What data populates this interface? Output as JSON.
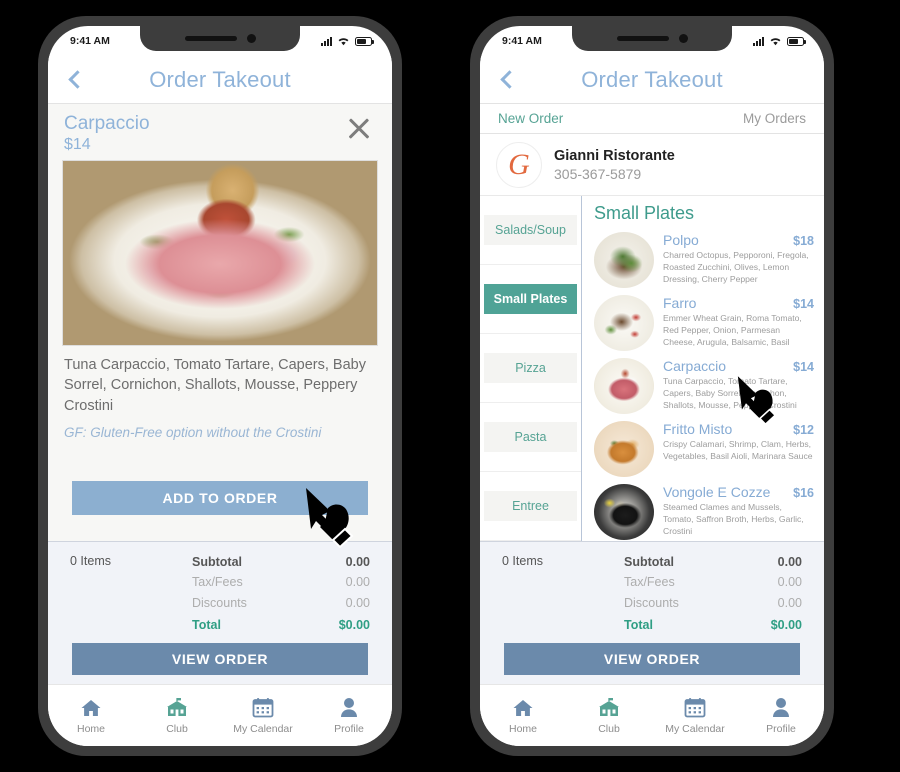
{
  "status_bar": {
    "time": "9:41 AM",
    "signal_icon": "cellular-signal-icon",
    "wifi_icon": "wifi-icon",
    "battery_icon": "battery-icon"
  },
  "nav": {
    "back_icon": "back-chevron-icon",
    "title": "Order Takeout"
  },
  "left_phone": {
    "detail": {
      "dish_name": "Carpaccio",
      "dish_price": "$14",
      "close_icon": "close-icon",
      "photo_alt": "carpaccio-dish-photo",
      "description": "Tuna Carpaccio, Tomato Tartare, Capers, Baby Sorrel, Cornichon, Shallots, Mousse, Peppery Crostini",
      "gf_note": "GF: Gluten-Free option without the Crostini",
      "add_button": "ADD TO ORDER"
    }
  },
  "right_phone": {
    "subtabs": {
      "new_order": "New Order",
      "my_orders": "My Orders"
    },
    "restaurant": {
      "logo_letter": "G",
      "name": "Gianni Ristorante",
      "phone": "305-367-5879"
    },
    "categories": [
      {
        "label": "Salads/Soup",
        "active": false
      },
      {
        "label": "Small Plates",
        "active": true
      },
      {
        "label": "Pizza",
        "active": false
      },
      {
        "label": "Pasta",
        "active": false
      },
      {
        "label": "Entree",
        "active": false
      }
    ],
    "section_title": "Small Plates",
    "items": [
      {
        "name": "Polpo",
        "price": "$18",
        "desc": "Charred Octopus, Pepporoni, Fregola, Roasted Zucchini, Olives, Lemon Dressing, Cherry Pepper",
        "thumb": "polpo-thumbnail"
      },
      {
        "name": "Farro",
        "price": "$14",
        "desc": "Emmer Wheat Grain, Roma Tomato, Red Pepper, Onion, Parmesan Cheese, Arugula, Balsamic, Basil",
        "thumb": "farro-thumbnail"
      },
      {
        "name": "Carpaccio",
        "price": "$14",
        "desc": "Tuna Carpaccio, Tomato Tartare, Capers, Baby Sorrel, Cornichon, Shallots, Mousse, Peppery Crostini",
        "thumb": "carpaccio-thumbnail"
      },
      {
        "name": "Fritto Misto",
        "price": "$12",
        "desc": "Crispy Calamari, Shrimp, Clam, Herbs, Vegetables, Basil Aioli, Marinara Sauce",
        "thumb": "fritto-misto-thumbnail"
      },
      {
        "name": "Vongole E Cozze",
        "price": "$16",
        "desc": "Steamed Clames and Mussels, Tomato, Saffron Broth, Herbs, Garlic, Crostini",
        "thumb": "vongole-e-cozze-thumbnail"
      }
    ]
  },
  "order_summary": {
    "items_count": "0 Items",
    "rows": [
      {
        "label": "Subtotal",
        "value": "0.00"
      },
      {
        "label": "Tax/Fees",
        "value": "0.00"
      },
      {
        "label": "Discounts",
        "value": "0.00"
      }
    ],
    "total_label": "Total",
    "total_value": "$0.00",
    "view_button": "VIEW ORDER"
  },
  "tabbar": [
    {
      "label": "Home",
      "icon": "home-icon"
    },
    {
      "label": "Club",
      "icon": "club-building-icon"
    },
    {
      "label": "My Calendar",
      "icon": "calendar-icon"
    },
    {
      "label": "Profile",
      "icon": "profile-person-icon"
    }
  ],
  "colors": {
    "accent_blue": "#8fb3d9",
    "button_blue": "#8cafd0",
    "view_order_blue": "#6b8aab",
    "teal": "#4fa396",
    "total_green": "#2f9e84",
    "logo_orange": "#e2693f",
    "frame_gray": "#3d3d3d"
  },
  "cursor": {
    "icon": "pointing-hand-cursor"
  }
}
